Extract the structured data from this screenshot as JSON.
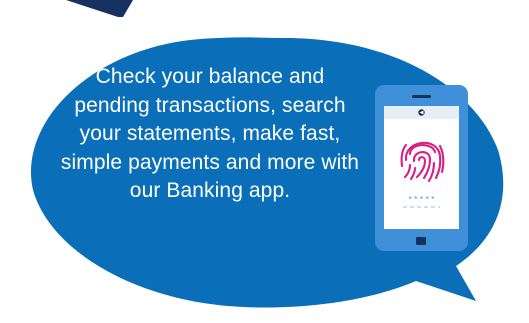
{
  "promo": {
    "message": "Check your balance and pending transactions, search your statements, make fast, simple payments and more with our Banking app.",
    "pin_mask": "* * * * *"
  },
  "colors": {
    "bubble": "#0a6fb8",
    "top_shape": "#16305f",
    "phone_body": "#3f8fd9",
    "fingerprint": "#d81e84",
    "text": "#ffffff"
  },
  "icons": {
    "top_corner": "dark-triangle-shape",
    "phone": "smartphone-icon",
    "fingerprint": "fingerprint-icon",
    "app_logo": "bank-logo-icon"
  }
}
